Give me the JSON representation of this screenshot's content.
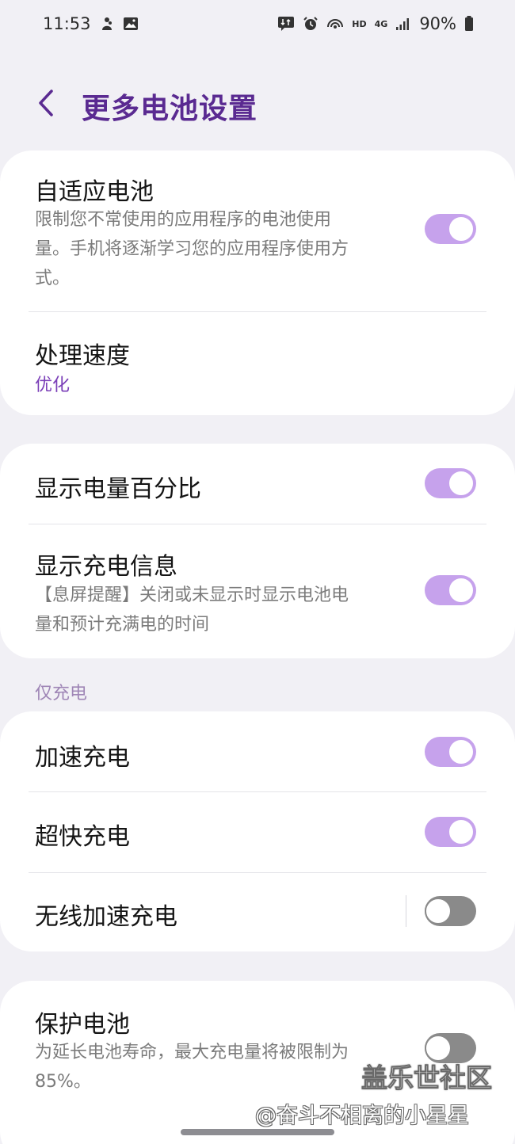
{
  "status_bar": {
    "time": "11:53",
    "left_icons": [
      "bixby-figure-icon",
      "gallery-image-icon"
    ],
    "right_icons": [
      "data-transfer-icon",
      "alarm-icon",
      "hotspot-icon",
      "hd-icon",
      "4g-icon",
      "signal-icon"
    ],
    "hd_label": "HD",
    "network_label": "4G",
    "battery": "90%"
  },
  "header": {
    "title": "更多电池设置",
    "back_icon": "chevron-left-icon"
  },
  "accent_color": "#5a2a91",
  "toggle_on_color": "#c6a2ec",
  "toggle_off_color": "#8a8a8a",
  "card1": {
    "adaptive": {
      "title": "自适应电池",
      "sub_lines": [
        "限制您不常使用的应用程序的电池使用",
        "量。手机将逐渐学习您的应用程序使用方",
        "式。"
      ],
      "on": true
    },
    "processing": {
      "title": "处理速度",
      "value": "优化"
    }
  },
  "card2": {
    "show_percent": {
      "title": "显示电量百分比",
      "on": true
    },
    "charging_info": {
      "title": "显示充电信息",
      "sub_lines": [
        "【息屏提醒】关闭或未显示时显示电池电",
        "量和预计充满电的时间"
      ],
      "on": true
    }
  },
  "section_charging": "仅充电",
  "card3": {
    "fast": {
      "title": "加速充电",
      "on": true
    },
    "super_fast": {
      "title": "超快充电",
      "on": true
    },
    "wireless_fast": {
      "title": "无线加速充电",
      "on": false
    }
  },
  "card4": {
    "protect": {
      "title": "保护电池",
      "sub_lines": [
        "为延长电池寿命，最大充电量将被限制为",
        "85%。"
      ],
      "on": false
    }
  },
  "watermark": {
    "brand": "盖乐世社区",
    "user": "@奋斗不相离的小星星"
  }
}
